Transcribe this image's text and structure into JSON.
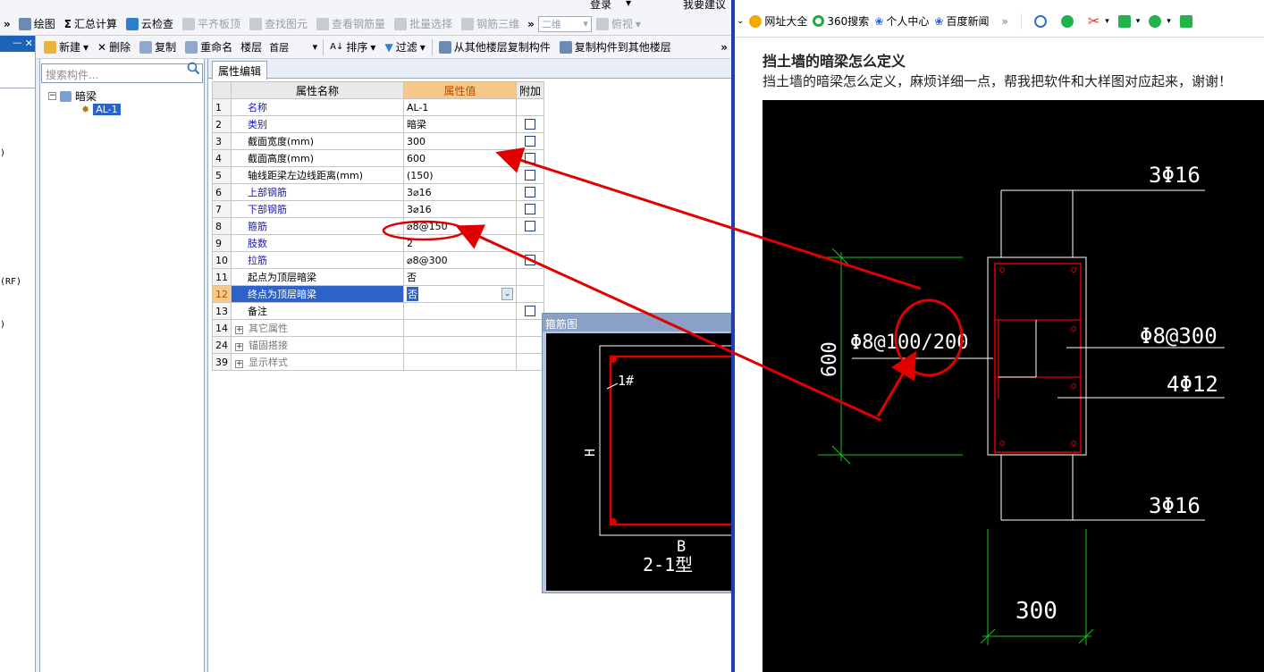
{
  "toolbar1": {
    "items": [
      {
        "label": "绘图",
        "icon": "draw-icon"
      },
      {
        "label": "汇总计算",
        "icon": "sigma-icon"
      },
      {
        "label": "云检查",
        "icon": "cloud-check-icon"
      },
      {
        "label": "平齐板顶",
        "icon": "align-icon"
      },
      {
        "label": "查找图元",
        "icon": "find-icon"
      },
      {
        "label": "查看钢筋量",
        "icon": "rebar-qty-icon"
      },
      {
        "label": "批量选择",
        "icon": "batch-select-icon"
      },
      {
        "label": "钢筋三维",
        "icon": "rebar-3d-icon"
      }
    ],
    "view_combo": "二维",
    "view2_combo": "俯视",
    "top_login": "登录",
    "top_feedback": "我要建议"
  },
  "toolbar2": {
    "new_label": "新建",
    "delete_label": "删除",
    "copy_label": "复制",
    "rename_label": "重命名",
    "floor_label": "楼层",
    "floor_value": "首层",
    "sort_label": "排序",
    "filter_label": "过滤",
    "copy_from_label": "从其他楼层复制构件",
    "copy_to_label": "复制构件到其他楼层"
  },
  "leftdock": {
    "pin": "ᅳ ✕",
    "frag1": ")",
    "frag2": "(RF)",
    "frag3": ")"
  },
  "tree": {
    "search_placeholder": "搜索构件...",
    "root": "暗梁",
    "child": "AL-1"
  },
  "props": {
    "tab": "属性编辑",
    "headers": {
      "num": "",
      "name": "属性名称",
      "value": "属性值",
      "extra": "附加"
    },
    "rows": [
      {
        "num": "1",
        "name": "名称",
        "value": "AL-1",
        "style": "blue",
        "cb": false
      },
      {
        "num": "2",
        "name": "类别",
        "value": "暗梁",
        "style": "blue",
        "cb": true
      },
      {
        "num": "3",
        "name": "截面宽度(mm)",
        "value": "300",
        "style": "black",
        "cb": true
      },
      {
        "num": "4",
        "name": "截面高度(mm)",
        "value": "600",
        "style": "black",
        "cb": true
      },
      {
        "num": "5",
        "name": "轴线距梁左边线距离(mm)",
        "value": "(150)",
        "style": "black",
        "cb": true
      },
      {
        "num": "6",
        "name": "上部钢筋",
        "value": "3⌀16",
        "style": "blue",
        "cb": true
      },
      {
        "num": "7",
        "name": "下部钢筋",
        "value": "3⌀16",
        "style": "blue",
        "cb": true
      },
      {
        "num": "8",
        "name": "箍筋",
        "value": "⌀8@150",
        "style": "blue",
        "cb": true
      },
      {
        "num": "9",
        "name": "肢数",
        "value": "2",
        "style": "blue",
        "cb": false
      },
      {
        "num": "10",
        "name": "拉筋",
        "value": "⌀8@300",
        "style": "blue",
        "cb": true
      },
      {
        "num": "11",
        "name": "起点为顶层暗梁",
        "value": "否",
        "style": "black",
        "cb": false
      },
      {
        "num": "12",
        "name": "终点为顶层暗梁",
        "value": "否",
        "style": "selected",
        "cb": false
      },
      {
        "num": "13",
        "name": "备注",
        "value": "",
        "style": "black",
        "cb": true
      },
      {
        "num": "14",
        "name": "其它属性",
        "value": "",
        "style": "group",
        "cb": false
      },
      {
        "num": "24",
        "name": "锚固搭接",
        "value": "",
        "style": "group",
        "cb": false
      },
      {
        "num": "39",
        "name": "显示样式",
        "value": "",
        "style": "group",
        "cb": false
      }
    ]
  },
  "stirrup": {
    "title": "箍筋图",
    "label_1": "1#",
    "label_h": "H",
    "label_b": "B",
    "type_label": "2-1型"
  },
  "browser": {
    "bookmarks": [
      {
        "label": "网址大全",
        "icon": "url-nav-icon"
      },
      {
        "label": "360搜索",
        "icon": "360-search-icon"
      },
      {
        "label": "个人中心",
        "icon": "paw-icon"
      },
      {
        "label": "百度新闻",
        "icon": "paw-icon"
      }
    ],
    "more": "»",
    "question_title": "挡土墙的暗梁怎么定义",
    "question_body": "挡土墙的暗梁怎么定义，麻烦详细一点，帮我把软件和大样图对应起来，谢谢！"
  },
  "cad": {
    "top_rebar": "3Φ16",
    "bottom_rebar": "3Φ16",
    "stirrup_spec": "Φ8@100/200",
    "tie_spec": "Φ8@300",
    "side_rebar": "4Φ12",
    "height_dim": "600",
    "width_dim": "300"
  },
  "colors": {
    "accent_blue": "#2d63c8",
    "header_orange": "#f7c88a",
    "annotation_red": "#e00000",
    "divider_blue": "#1f3fb0"
  }
}
